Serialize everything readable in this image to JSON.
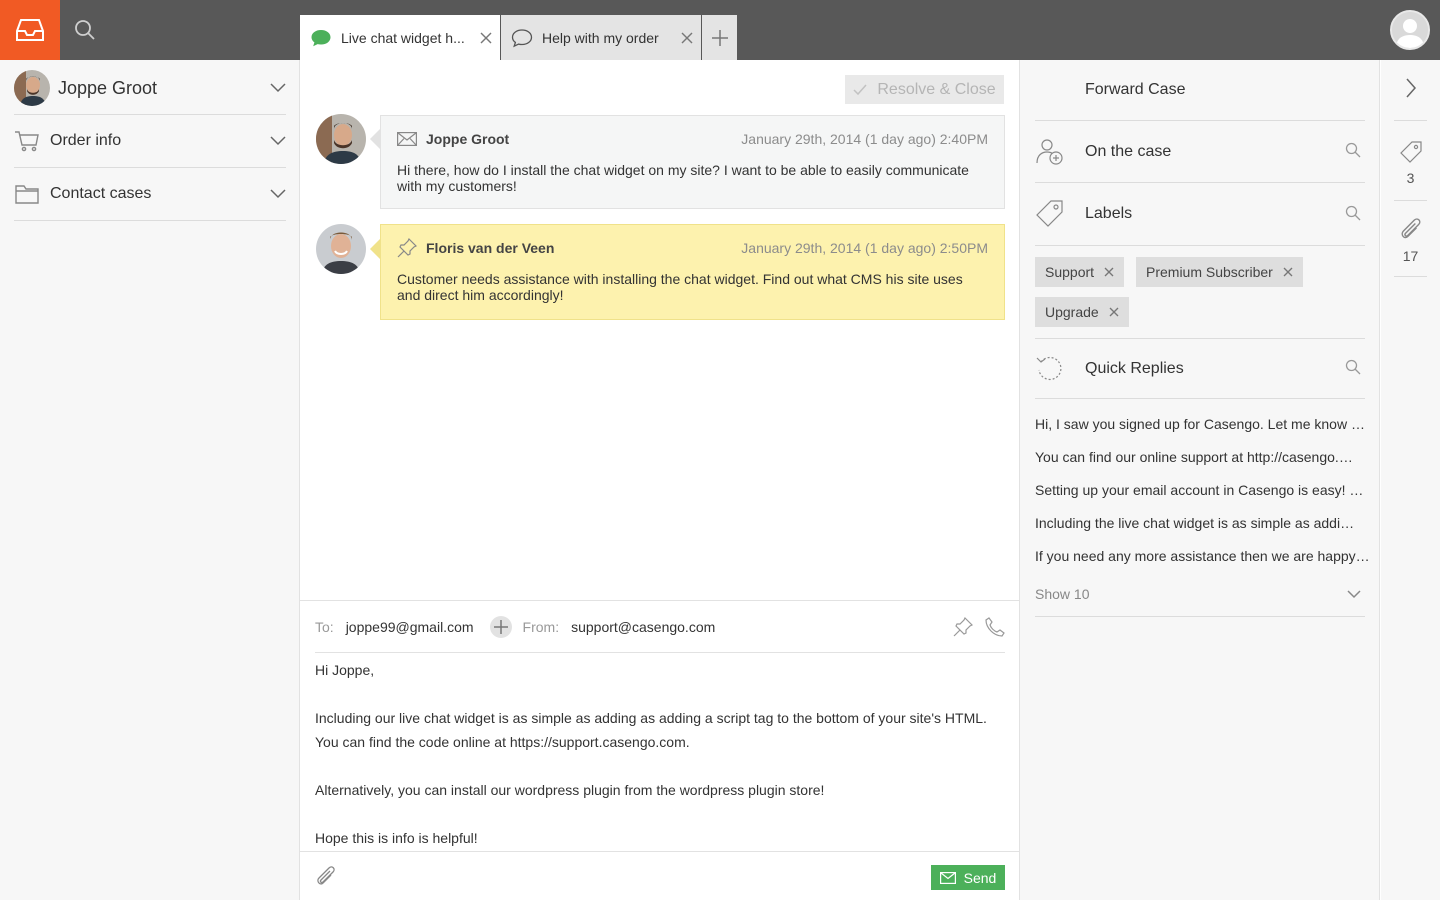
{
  "topbar": {
    "tabs": [
      {
        "label": "Live chat widget h...",
        "icon": "chat-bubble-filled-icon",
        "active": true
      },
      {
        "label": "Help with my order",
        "icon": "chat-bubble-outline-icon",
        "active": false
      }
    ],
    "brand_color": "#f15a24"
  },
  "sidebar": {
    "contact_name": "Joppe Groot",
    "items": [
      {
        "label": "Order info",
        "icon": "cart-icon"
      },
      {
        "label": "Contact cases",
        "icon": "folder-icon"
      }
    ]
  },
  "conversation": {
    "resolve_label": "Resolve & Close",
    "messages": [
      {
        "type": "email",
        "author": "Joppe Groot",
        "time": "January 29th, 2014 (1 day ago) 2:40PM",
        "body": "Hi there, how do I install the chat widget on my site? I want to be able to easily communicate with my customers!"
      },
      {
        "type": "note",
        "author": "Floris van der Veen",
        "time": "January 29th, 2014 (1 day ago) 2:50PM",
        "body": "Customer needs assistance with installing the chat widget. Find out what CMS his site uses and direct him accordingly!"
      }
    ]
  },
  "composer": {
    "to_label": "To:",
    "to_value": "joppe99@gmail.com",
    "from_label": "From:",
    "from_value": "support@casengo.com",
    "body_lines": [
      "Hi Joppe,",
      "",
      "Including our live chat widget is as simple as adding as adding a script tag to the bottom of your site's HTML.",
      "You can find the code online at https://support.casengo.com.",
      "",
      "Alternatively, you can install our wordpress plugin from the wordpress plugin store!",
      "",
      "Hope this is info is helpful!"
    ],
    "send_label": "Send",
    "send_color": "#4cb05a"
  },
  "right_panel": {
    "forward_label": "Forward Case",
    "on_case_label": "On the case",
    "labels_title": "Labels",
    "labels": [
      "Support",
      "Premium Subscriber",
      "Upgrade"
    ],
    "quick_replies_title": "Quick Replies",
    "quick_replies": [
      "Hi, I saw you signed up for Casengo. Let me know if you need any help.",
      "You can find our online support at http://casengo.com/support",
      "Setting up your email account in Casengo is easy! Just follow these steps",
      "Including the live chat widget is as simple as adding a script tag",
      "If you need any more assistance then we are happy to help you."
    ],
    "show_more_label": "Show 10"
  },
  "rail": {
    "labels_count": "3",
    "attachments_count": "17"
  }
}
